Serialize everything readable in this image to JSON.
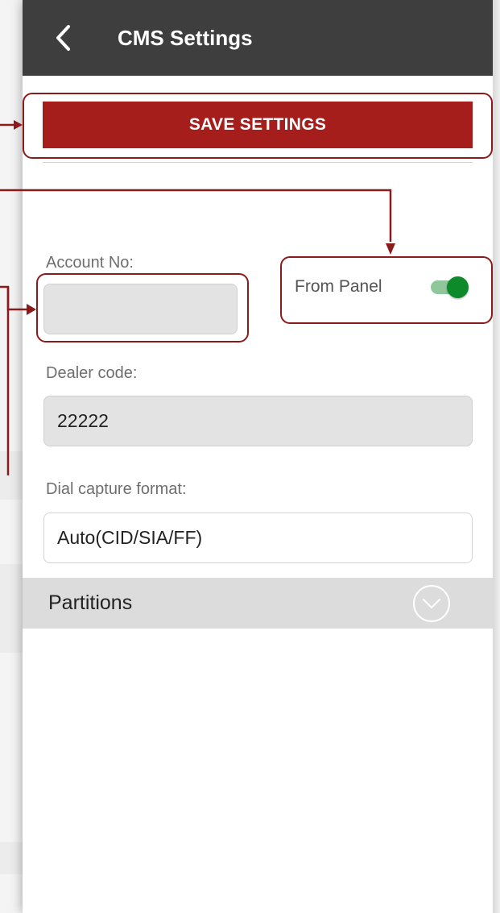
{
  "header": {
    "title": "CMS Settings",
    "back_icon": "chevron-left-icon"
  },
  "actions": {
    "save_label": "SAVE SETTINGS"
  },
  "form": {
    "account_no": {
      "label": "Account No:",
      "value": ""
    },
    "from_panel": {
      "label": "From Panel",
      "enabled": true
    },
    "dealer_code": {
      "label": "Dealer code:",
      "value": "22222"
    },
    "dial_capture_format": {
      "label": "Dial capture format:",
      "value": "Auto(CID/SIA/FF)"
    }
  },
  "sections": {
    "partitions": {
      "label": "Partitions",
      "expand_icon": "circle-chevron-down-icon"
    }
  },
  "colors": {
    "header_bg": "#3e3e3e",
    "primary": "#a51e1b",
    "toggle_on": "#0e8a2b",
    "callout": "#8b1a1a"
  }
}
